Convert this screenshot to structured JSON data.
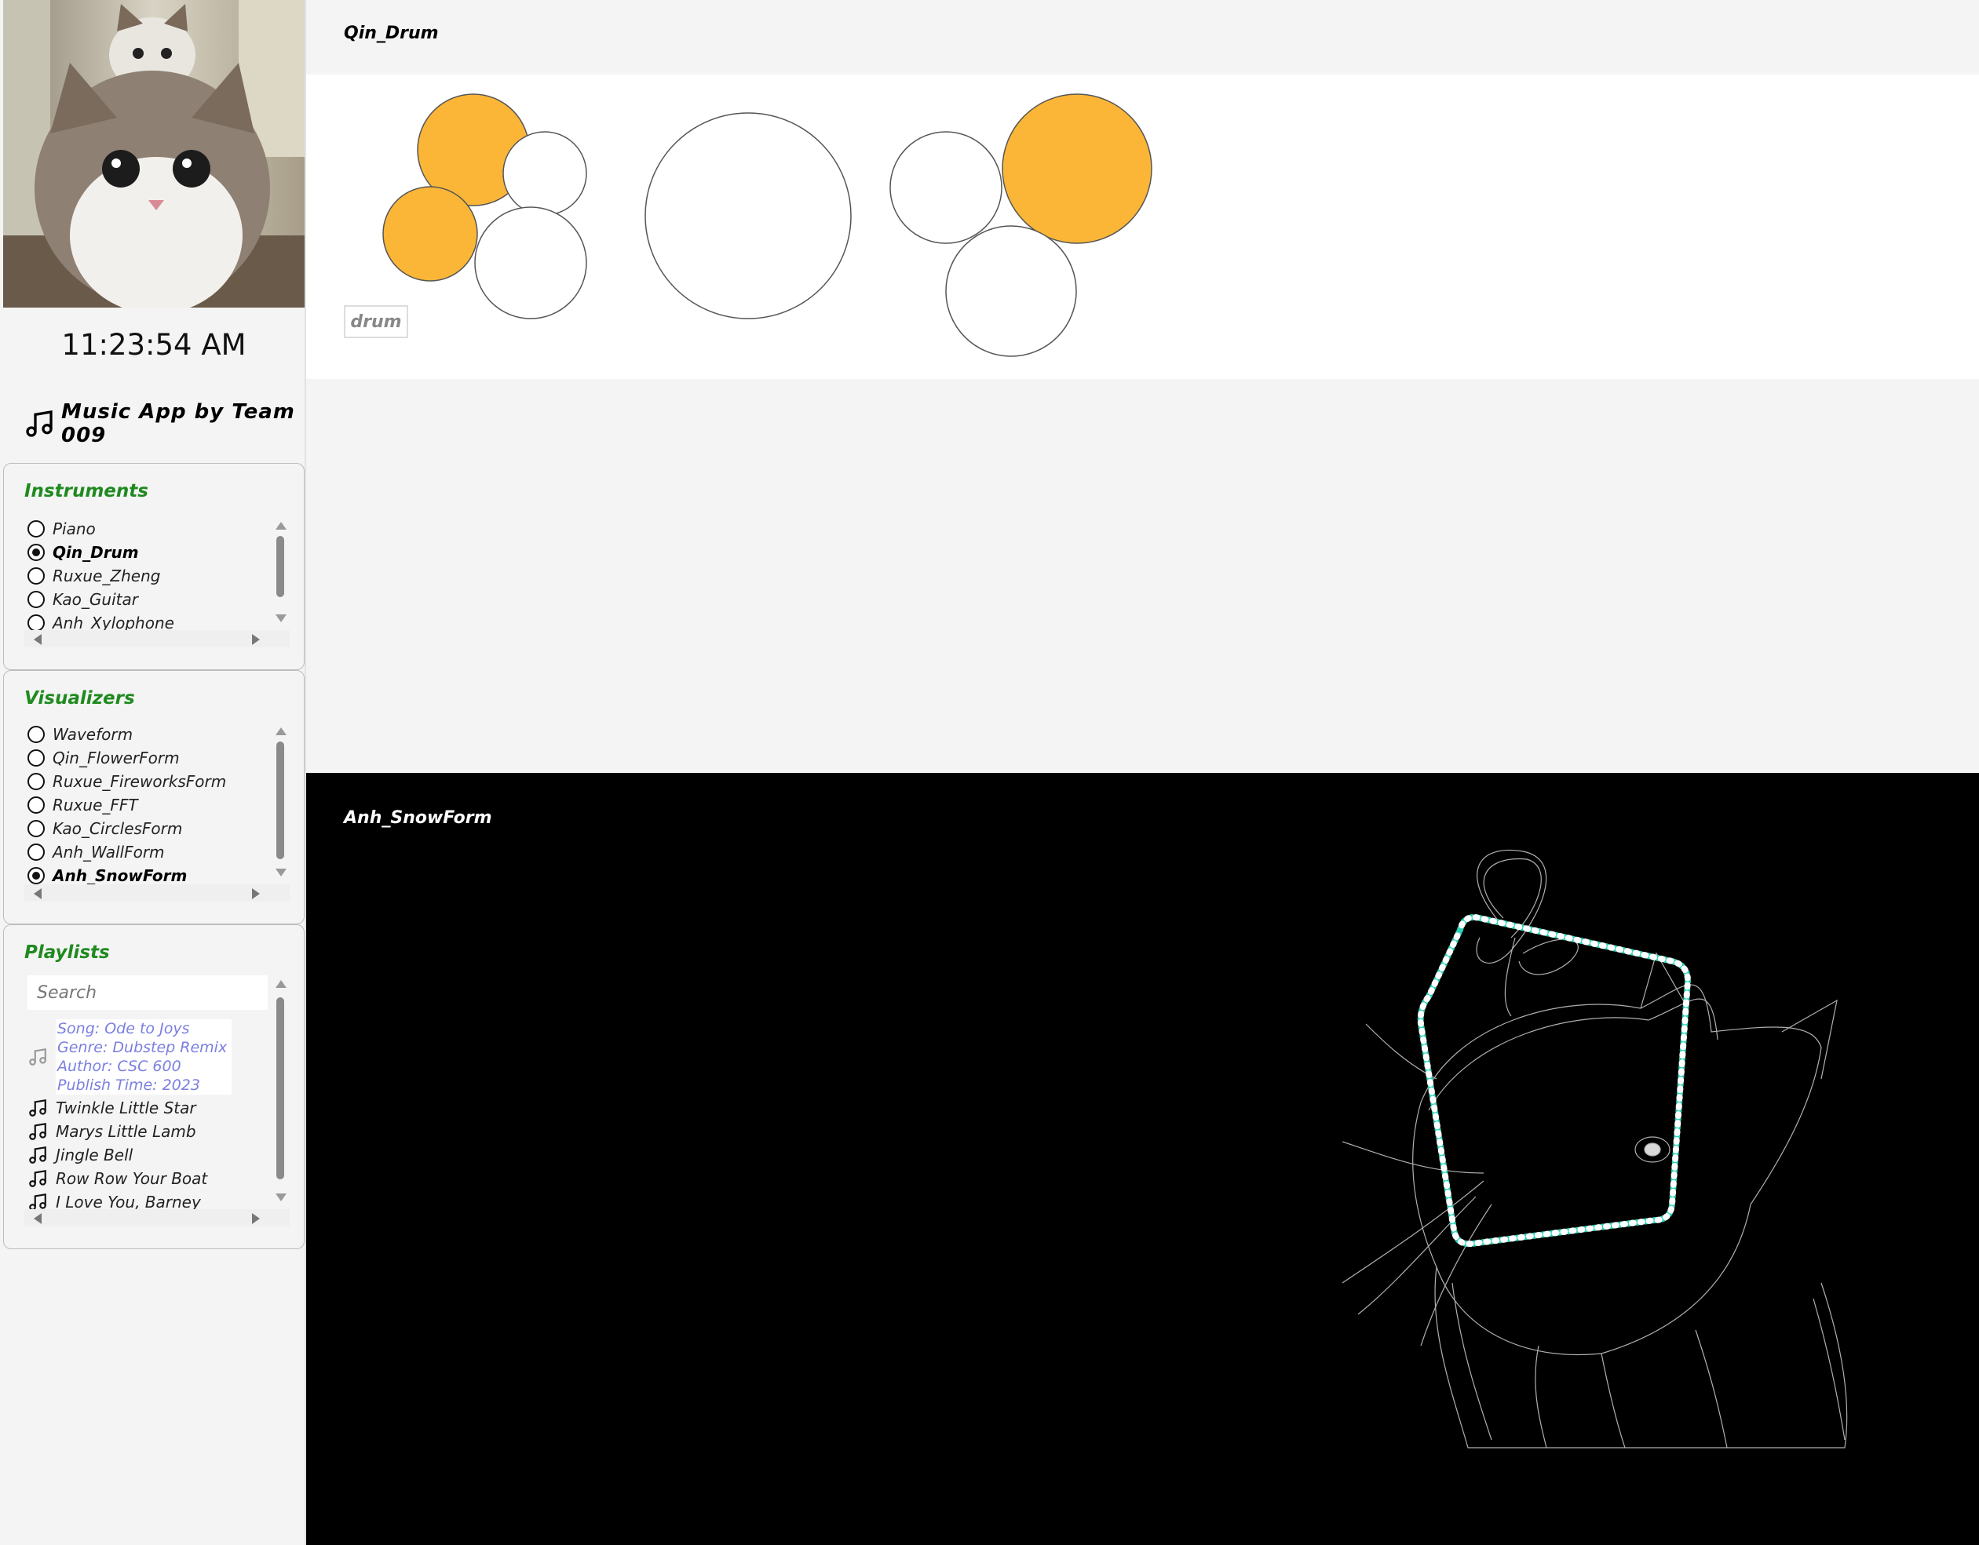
{
  "sidebar": {
    "clock": "11:23:54 AM",
    "app_title": "Music App by Team 009",
    "instruments": {
      "title": "Instruments",
      "items": [
        {
          "label": "Piano",
          "selected": false
        },
        {
          "label": "Qin_Drum",
          "selected": true
        },
        {
          "label": "Ruxue_Zheng",
          "selected": false
        },
        {
          "label": "Kao_Guitar",
          "selected": false
        },
        {
          "label": "Anh_Xylophone",
          "selected": false
        }
      ]
    },
    "visualizers": {
      "title": "Visualizers",
      "items": [
        {
          "label": "Waveform",
          "selected": false
        },
        {
          "label": "Qin_FlowerForm",
          "selected": false
        },
        {
          "label": "Ruxue_FireworksForm",
          "selected": false
        },
        {
          "label": "Ruxue_FFT",
          "selected": false
        },
        {
          "label": "Kao_CirclesForm",
          "selected": false
        },
        {
          "label": "Anh_WallForm",
          "selected": false
        },
        {
          "label": "Anh_SnowForm",
          "selected": true
        }
      ]
    },
    "playlists": {
      "title": "Playlists",
      "search_placeholder": "Search",
      "selected_song": {
        "song": "Song: Ode to Joys",
        "genre": "Genre: Dubstep Remix",
        "author": "Author: CSC 600",
        "publish_time": "Publish Time: 2023"
      },
      "songs": [
        "Twinkle Little Star",
        "Marys Little Lamb",
        "Jingle Bell",
        "Row Row Your Boat",
        "I Love You, Barney"
      ]
    }
  },
  "instrument": {
    "title": "Qin_Drum",
    "drum_label": "drum",
    "accent_color": "#fbb637"
  },
  "visualizer": {
    "title": "Anh_SnowForm",
    "dot_colors": [
      "#ffffff",
      "#2fd1b5"
    ]
  }
}
